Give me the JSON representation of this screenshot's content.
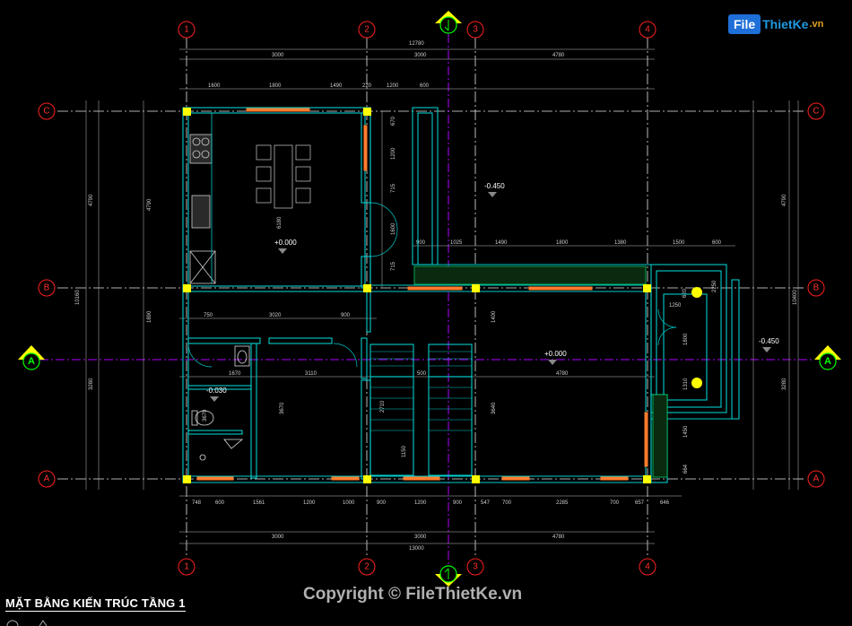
{
  "title": "MẶT BẰNG KIẾN TRÚC TẦNG 1",
  "copyright": "Copyright © FileThietKe.vn",
  "logo": {
    "badge": "File",
    "text": "ThietKe",
    "ext": ".vn"
  },
  "axes": {
    "vertical": [
      "1",
      "2",
      "3",
      "4"
    ],
    "horizontal": [
      "C",
      "B",
      "A"
    ],
    "section": "A"
  },
  "levels": [
    "+0.000",
    "-0.450",
    "+0.000",
    "-0.030",
    "-0.450"
  ],
  "dims": {
    "top_overall": "12780",
    "top_axes": [
      "3000",
      "3000",
      "4780"
    ],
    "top_detail": [
      "1600",
      "1800",
      "1490",
      "220",
      "1200",
      "600"
    ],
    "right_detail": [
      "900",
      "1025",
      "1490",
      "1800",
      "1380",
      "1500",
      "600"
    ],
    "mid_detail": [
      "750",
      "3020",
      "900"
    ],
    "mid_detail2": [
      "1670",
      "3110",
      "500",
      "4780"
    ],
    "bottom_detail": [
      "748",
      "600",
      "1561",
      "1200",
      "1000",
      "900",
      "1200",
      "900",
      "547",
      "700",
      "2285",
      "700",
      "657",
      "646"
    ],
    "bottom_axes": [
      "3000",
      "3000",
      "4780"
    ],
    "bottom_overall": "13000",
    "left_overall": "10160",
    "left_parts": [
      "4790",
      "1890",
      "3280",
      "3670"
    ],
    "right_parts": [
      "4790",
      "3280"
    ],
    "right_overall": "10400",
    "vert_small": [
      "670",
      "1200",
      "715",
      "1600",
      "715",
      "6180",
      "1400",
      "3640",
      "3670",
      "2710",
      "1150",
      "620",
      "1250",
      "1800",
      "1310",
      "1450",
      "664",
      "2250"
    ]
  },
  "colors": {
    "background": "#000000",
    "grid": "#ffffff",
    "axis_bubble": "#ff0000",
    "wall": "#00d0d0",
    "column": "#ffff00",
    "section": "#c000ff",
    "door": "#ff8040"
  }
}
